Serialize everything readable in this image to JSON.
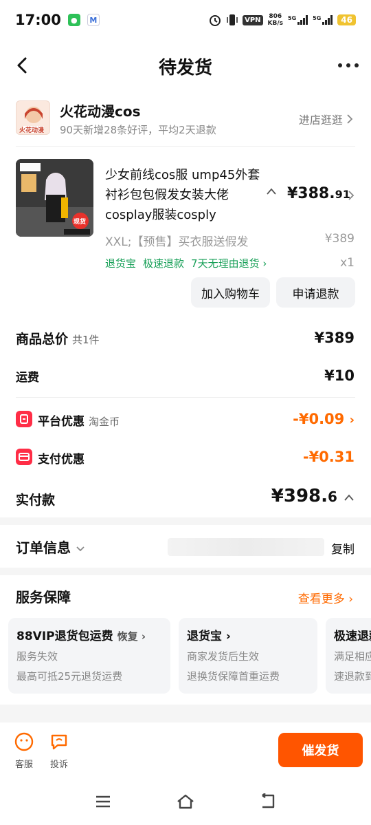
{
  "status_bar": {
    "time": "17:00",
    "vpn": "VPN",
    "speed_value": "806",
    "speed_unit": "KB/s",
    "net1": "5G",
    "net2": "5G",
    "battery": "46"
  },
  "nav": {
    "title": "待发货"
  },
  "shop": {
    "logo_text": "火花动漫",
    "name": "火花动漫cos",
    "subtitle": "90天新增28条好评，平均2天退款",
    "link": "进店逛逛"
  },
  "product": {
    "title": "少女前线cos服 ump45外套衬衫包包假发女装大佬cosplay服装cosply",
    "price_main": "¥388.",
    "price_decimal": "91",
    "spec": "XXL;【预售】买衣服送假发",
    "original_price": "¥389",
    "tags": [
      "退货宝",
      "极速退款",
      "7天无理由退货"
    ],
    "quantity": "x1",
    "image_badge": "现货",
    "buttons": {
      "add_cart": "加入购物车",
      "refund": "申请退款"
    }
  },
  "summary": {
    "total_label": "商品总价",
    "total_count": "共1件",
    "total_value": "¥389",
    "shipping_label": "运费",
    "shipping_value": "¥10",
    "platform_label": "平台优惠",
    "platform_sub": "淘金币",
    "platform_value": "-¥0.09",
    "payment_label": "支付优惠",
    "payment_value": "-¥0.31",
    "paid_label": "实付款",
    "paid_main": "¥398.",
    "paid_decimal": "6"
  },
  "order_info": {
    "title": "订单信息",
    "copy": "复制"
  },
  "service": {
    "title": "服务保障",
    "more": "查看更多",
    "cards": [
      {
        "title": "88VIP退货包运费",
        "action": "恢复",
        "line1": "服务失效",
        "line2": "最高可抵25元退货运费"
      },
      {
        "title": "退货宝",
        "action": "",
        "line1": "商家发货后生效",
        "line2": "退换货保障首重运费"
      },
      {
        "title": "极速退款",
        "action": "",
        "line1": "满足相应条件时",
        "line2": "速退款到账"
      }
    ]
  },
  "bottom": {
    "service": "客服",
    "complain": "投诉",
    "urge": "催发货"
  },
  "colors": {
    "accent": "#ff5500",
    "green": "#18a058",
    "discount": "#ff6a00"
  }
}
